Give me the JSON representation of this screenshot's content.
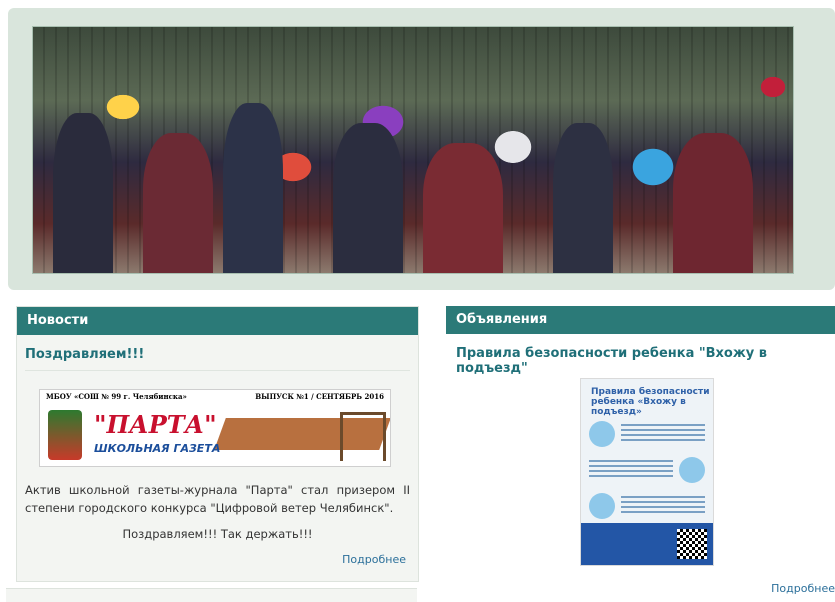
{
  "news_panel": {
    "header": "Новости",
    "item_title": "Поздравляем!!!",
    "newspaper": {
      "top_left": "МБОУ «СОШ № 99 г. Челябинска»",
      "top_right": "ВЫПУСК №1 / СЕНТЯБРЬ 2016",
      "name": "\"ПАРТА\"",
      "subtitle": "ШКОЛЬНАЯ ГАЗЕТА"
    },
    "text": "Актив школьной газеты-журнала \"Парта\" стал призером II степени городского конкурса \"Цифровой ветер Челябинск\".",
    "congrats": "Поздравляем!!! Так держать!!!",
    "more": "Подробнее"
  },
  "ann_panel": {
    "header": "Объявления",
    "item_title": "Правила безопасности ребенка \"Вхожу в подъезд\"",
    "poster_title": "Правила безопасности ребенка «Вхожу в подъезд»",
    "more": "Подробнее"
  }
}
